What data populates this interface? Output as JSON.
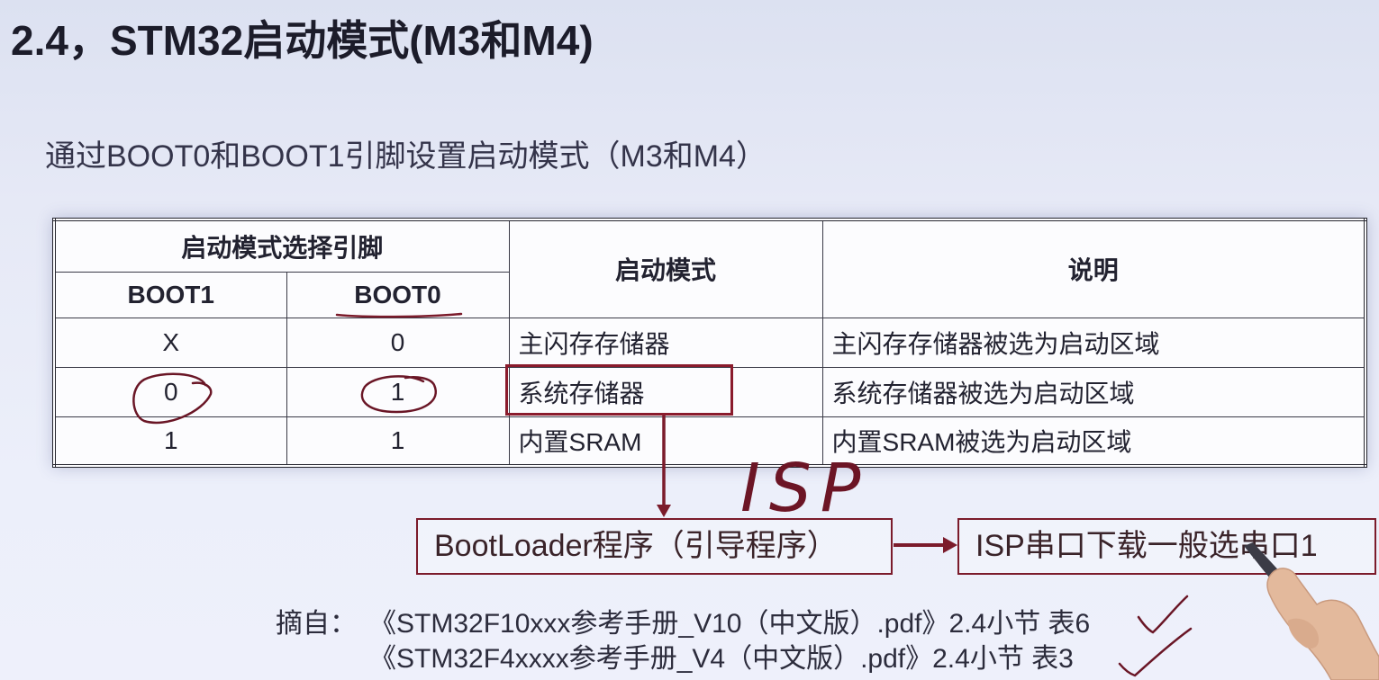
{
  "slide": {
    "title": "2.4，STM32启动模式(M3和M4)",
    "subtitle": "通过BOOT0和BOOT1引脚设置启动模式（M3和M4）"
  },
  "table": {
    "group_header": "启动模式选择引脚",
    "pin_headers": [
      "BOOT1",
      "BOOT0"
    ],
    "mode_header": "启动模式",
    "desc_header": "说明",
    "rows": [
      {
        "boot1": "X",
        "boot0": "0",
        "mode": "主闪存存储器",
        "desc": "主闪存存储器被选为启动区域"
      },
      {
        "boot1": "0",
        "boot0": "1",
        "mode": "系统存储器",
        "desc": "系统存储器被选为启动区域"
      },
      {
        "boot1": "1",
        "boot0": "1",
        "mode": "内置SRAM",
        "desc": "内置SRAM被选为启动区域"
      }
    ]
  },
  "flow": {
    "bootloader": "BootLoader程序（引导程序）",
    "isp_download": "ISP串口下载一般选串口1"
  },
  "annotations": {
    "handwritten_label": "ISP"
  },
  "source": {
    "prefix": "摘自：",
    "refs": [
      "《STM32F10xxx参考手册_V10（中文版）.pdf》2.4小节 表6",
      "《STM32F4xxxx参考手册_V4（中文版）.pdf》2.4小节 表3"
    ]
  },
  "colors": {
    "background": "#e8ebf7",
    "text": "#1f1f2d",
    "annotation_red": "#7b1b2b",
    "table_border": "#26262f"
  }
}
